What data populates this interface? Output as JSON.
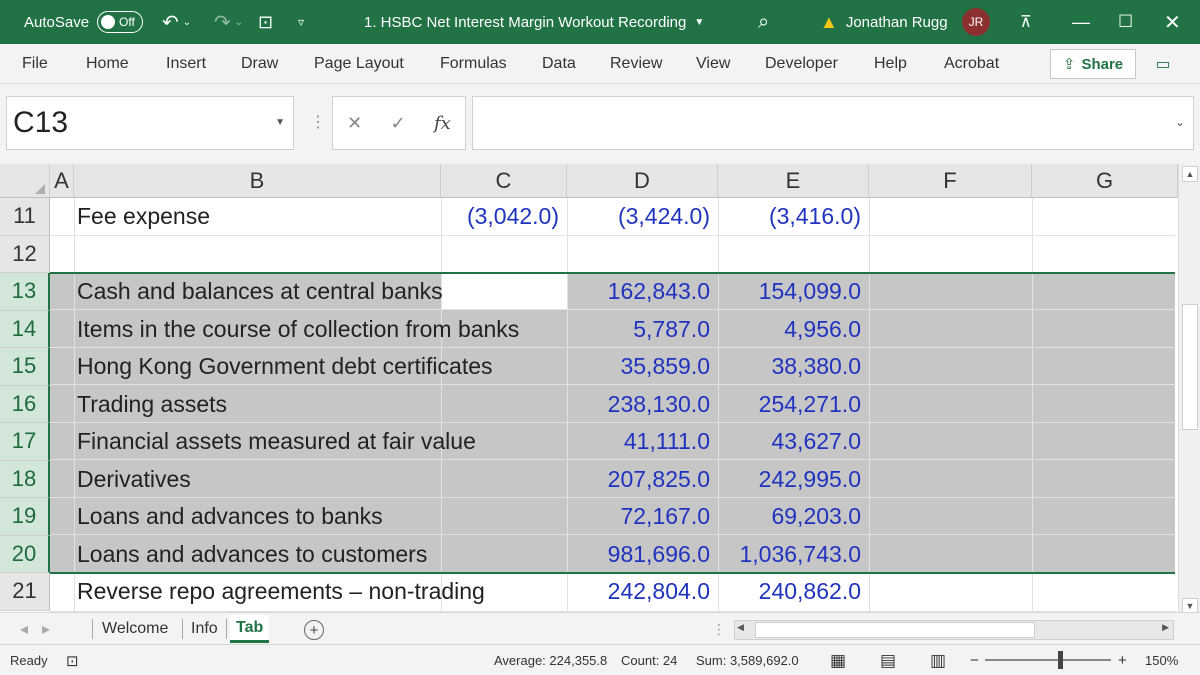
{
  "titlebar": {
    "autosave_label": "AutoSave",
    "autosave_state": "Off",
    "document_title": "1. HSBC Net Interest Margin Workout Recording",
    "warning_icon": "warning-icon",
    "user_name": "Jonathan Rugg",
    "user_initials": "JR"
  },
  "ribbon": {
    "tabs": [
      "File",
      "Home",
      "Insert",
      "Draw",
      "Page Layout",
      "Formulas",
      "Data",
      "Review",
      "View",
      "Developer",
      "Help",
      "Acrobat"
    ],
    "share_label": "Share"
  },
  "formula_bar": {
    "name_box": "C13",
    "fx_label": "fx",
    "formula": ""
  },
  "grid": {
    "columns": [
      "A",
      "B",
      "C",
      "D",
      "E",
      "F",
      "G"
    ],
    "rows": [
      {
        "num": "11",
        "label": "Fee expense",
        "c": "(3,042.0)",
        "d": "(3,424.0)",
        "e": "(3,416.0)"
      },
      {
        "num": "12",
        "label": "",
        "c": "",
        "d": "",
        "e": ""
      },
      {
        "num": "13",
        "label": "Cash and balances at central banks",
        "c": "",
        "d": "162,843.0",
        "e": "154,099.0"
      },
      {
        "num": "14",
        "label": "Items in the course of collection from banks",
        "c": "",
        "d": "5,787.0",
        "e": "4,956.0"
      },
      {
        "num": "15",
        "label": "Hong Kong Government debt certificates",
        "c": "",
        "d": "35,859.0",
        "e": "38,380.0"
      },
      {
        "num": "16",
        "label": "Trading assets",
        "c": "",
        "d": "238,130.0",
        "e": "254,271.0"
      },
      {
        "num": "17",
        "label": "Financial assets measured at fair value",
        "c": "",
        "d": "41,111.0",
        "e": "43,627.0"
      },
      {
        "num": "18",
        "label": "Derivatives",
        "c": "",
        "d": "207,825.0",
        "e": "242,995.0"
      },
      {
        "num": "19",
        "label": "Loans and advances to banks",
        "c": "",
        "d": "72,167.0",
        "e": "69,203.0"
      },
      {
        "num": "20",
        "label": "Loans and advances to customers",
        "c": "",
        "d": "981,696.0",
        "e": "1,036,743.0"
      },
      {
        "num": "21",
        "label": "Reverse repo agreements – non-trading",
        "c": "",
        "d": "242,804.0",
        "e": "240,862.0"
      }
    ]
  },
  "sheets": {
    "tabs": [
      "Welcome",
      "Info",
      "Tab"
    ],
    "active": "Tab"
  },
  "status": {
    "mode": "Ready",
    "average": "Average: 224,355.8",
    "count": "Count: 24",
    "sum": "Sum: 3,589,692.0",
    "zoom": "150%"
  },
  "colors": {
    "excel_green": "#217346",
    "number_blue": "#1f33bf",
    "selection_gray": "#c6c6c6"
  }
}
